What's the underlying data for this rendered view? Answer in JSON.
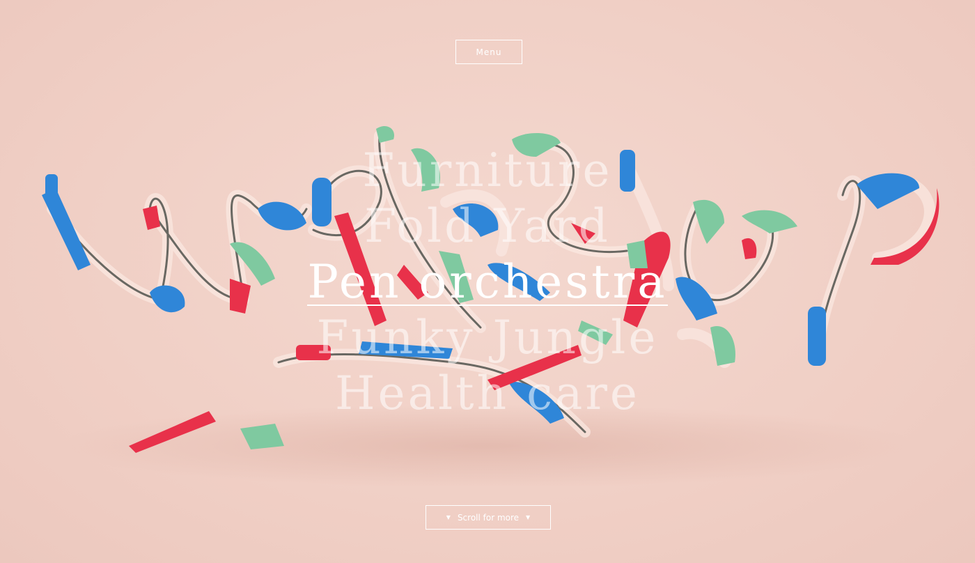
{
  "menu": {
    "label": "Menu"
  },
  "projects": [
    {
      "label": "Furniture"
    },
    {
      "label": "Fold Yard"
    },
    {
      "label": "Pen orchestra"
    },
    {
      "label": "Funky Jungle"
    },
    {
      "label": "Health care"
    }
  ],
  "active_project": "Pen orchestra",
  "scroll": {
    "label": "Scroll for more",
    "icon_left": "chevron-down-icon",
    "icon_right": "chevron-down-icon"
  },
  "colors": {
    "background": "#f1d2c9",
    "pen_blue": "#2f86d8",
    "pen_red": "#e8314a",
    "pen_green": "#7fc9a0",
    "text": "#ffffff"
  }
}
